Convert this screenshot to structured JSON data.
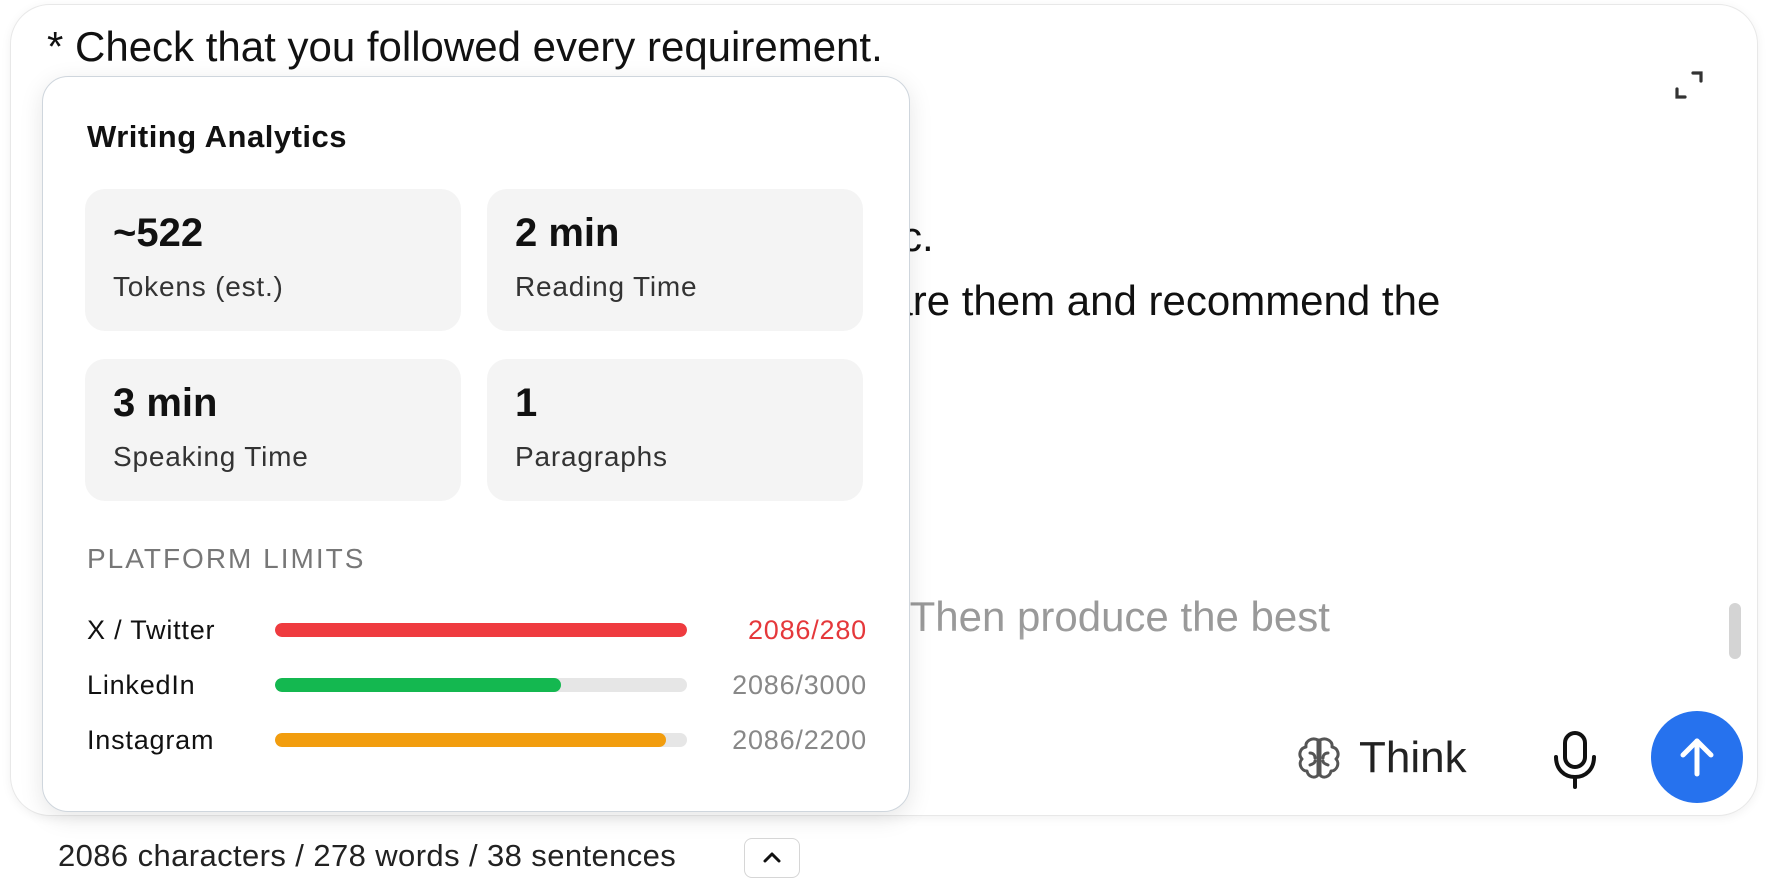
{
  "prompt": {
    "lines": [
      "* Check that you followed every requirement.",
      "neric.",
      "mpare them and recommend the",
      "nts. Then produce the best"
    ]
  },
  "toolbar": {
    "think_label": "Think",
    "expand_icon": "expand-icon",
    "mic_icon": "microphone-icon",
    "send_icon": "arrow-up-icon",
    "send_color": "#2672ee"
  },
  "analytics": {
    "title": "Writing Analytics",
    "stats": [
      {
        "value": "~522",
        "label": "Tokens (est.)"
      },
      {
        "value": "2 min",
        "label": "Reading Time"
      },
      {
        "value": "3 min",
        "label": "Speaking Time"
      },
      {
        "value": "1",
        "label": "Paragraphs"
      }
    ],
    "limits_title": "PLATFORM LIMITS",
    "limits": [
      {
        "name": "X / Twitter",
        "count": "2086/280",
        "fraction": 1.0,
        "color": "#ef3b3f",
        "count_color": "#e5383b"
      },
      {
        "name": "LinkedIn",
        "count": "2086/3000",
        "fraction": 0.6953,
        "color": "#14b850",
        "count_color": "#888888"
      },
      {
        "name": "Instagram",
        "count": "2086/2200",
        "fraction": 0.9482,
        "color": "#f29d0e",
        "count_color": "#888888"
      }
    ]
  },
  "footer": {
    "stats_text": "2086 characters / 278 words / 38 sentences",
    "collapse_icon": "chevron-up-icon"
  }
}
